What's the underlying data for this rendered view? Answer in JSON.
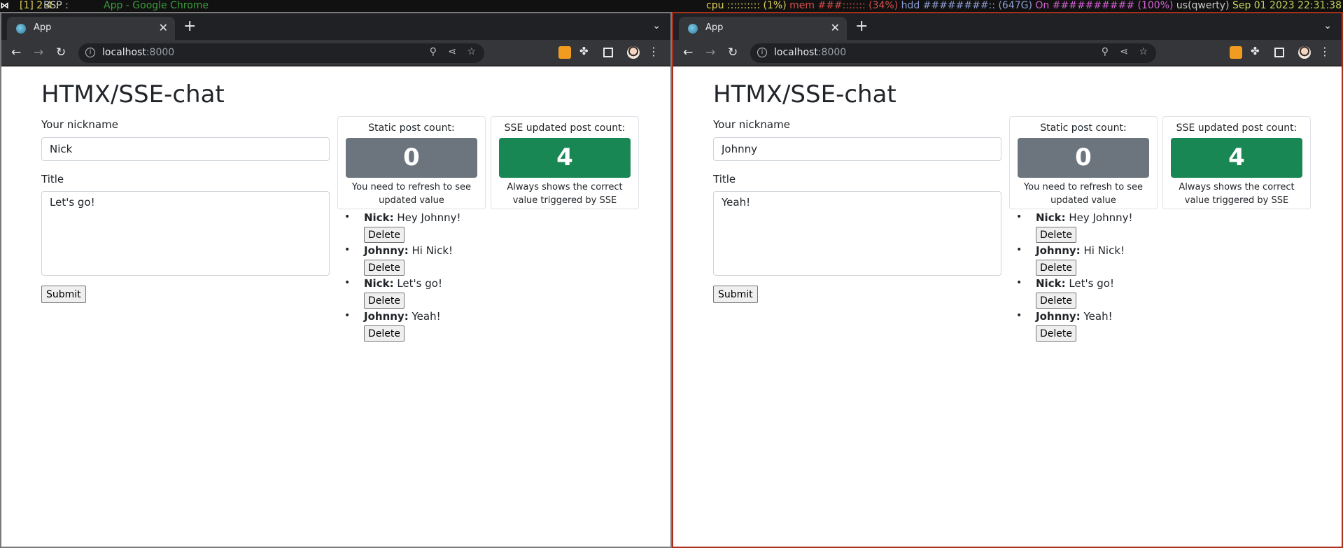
{
  "statusbar": {
    "workspaces": "[1] 2 4 :",
    "layout": "BSP :",
    "active_window": "App - Google Chrome",
    "cpu": "cpu :::::::::: (1%)",
    "mem": "mem ###::::::: (34%)",
    "hdd": "hdd ########:: (647G)",
    "power": "On ########## (100%)",
    "keyboard": "us(qwerty)",
    "datetime": "Sep 01 2023  22:31:38"
  },
  "browser": {
    "tab_title": "App",
    "host": "localhost",
    "port": ":8000"
  },
  "app": {
    "heading": "HTMX/SSE-chat",
    "nickname_label": "Your nickname",
    "title_label": "Title",
    "submit_label": "Submit",
    "static_card": {
      "header": "Static post count:",
      "value": "0",
      "note": "You need to refresh to see updated value"
    },
    "sse_card": {
      "header": "SSE updated post count:",
      "value": "4",
      "note": "Always shows the correct value triggered by SSE"
    },
    "delete_label": "Delete",
    "posts": [
      {
        "author": "Nick:",
        "text": "Hey Johnny!"
      },
      {
        "author": "Johnny:",
        "text": "Hi Nick!"
      },
      {
        "author": "Nick:",
        "text": "Let's go!"
      },
      {
        "author": "Johnny:",
        "text": "Yeah!"
      }
    ]
  },
  "left_window": {
    "nickname_value": "Nick",
    "title_value": "Let's go!"
  },
  "right_window": {
    "nickname_value": "Johnny",
    "title_value": "Yeah!"
  },
  "colors": {
    "gray_badge": "#6c757d",
    "green_badge": "#198754",
    "right_window_border": "#a8301f"
  }
}
